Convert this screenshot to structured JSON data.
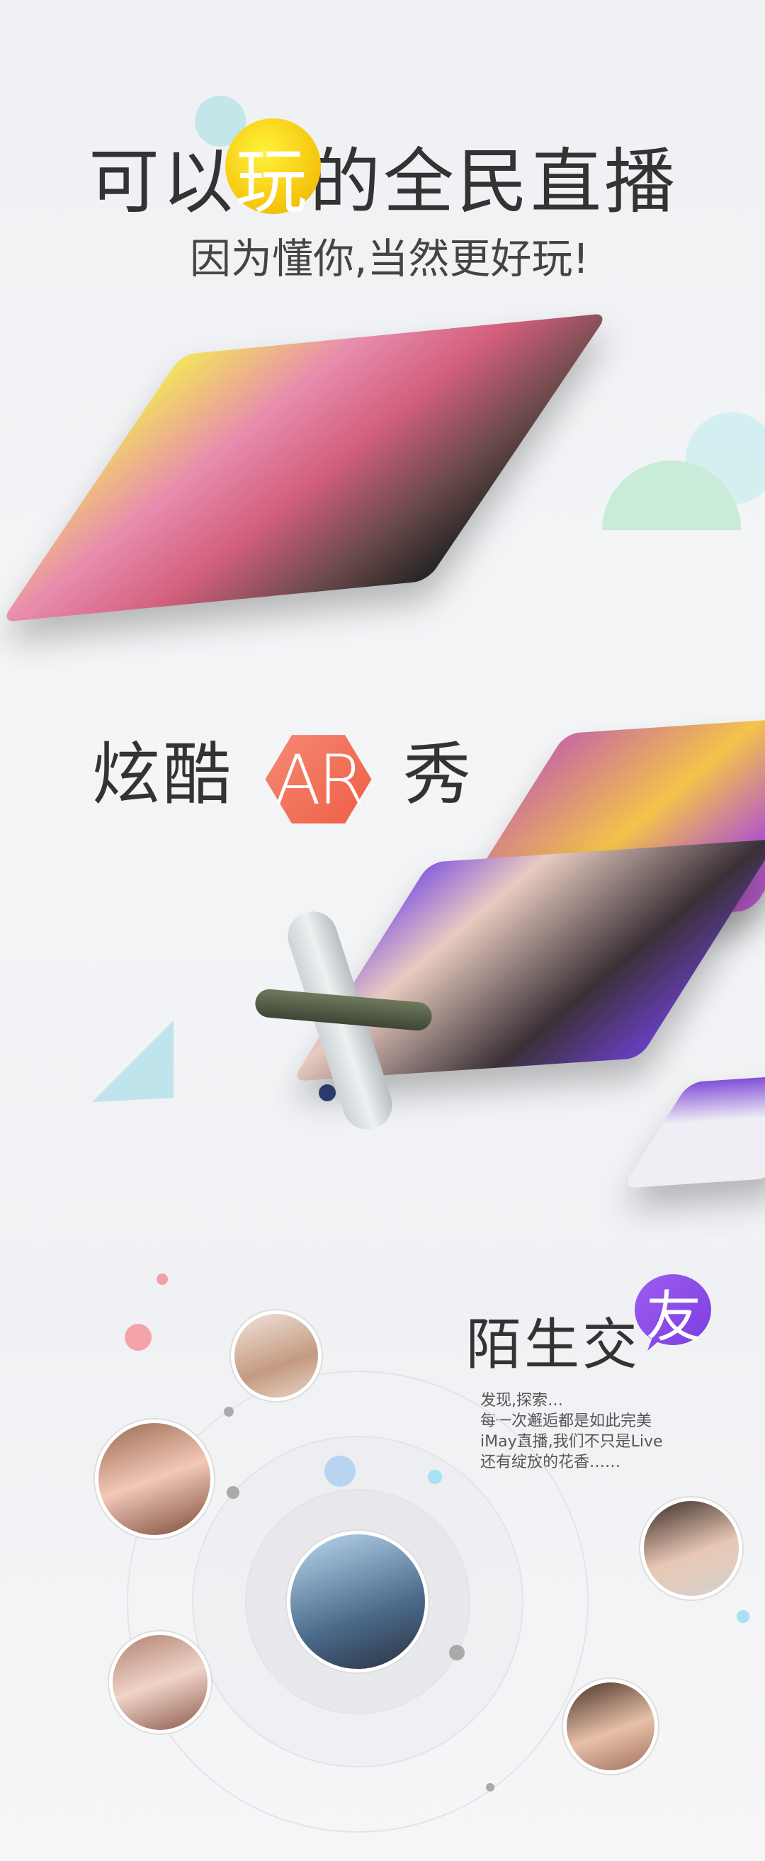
{
  "section1": {
    "title_before": "可以",
    "title_highlight": "玩",
    "title_after": "的全民直播",
    "subtitle": "因为懂你,当然更好玩!"
  },
  "section2": {
    "title_before": "炫酷",
    "title_highlight": "AR",
    "title_after": "秀"
  },
  "section3": {
    "title_main": "陌生交",
    "title_highlight": "友",
    "description": [
      "发现,探索…",
      "每一次邂逅都是如此完美",
      "iMay直播,我们不只是Live",
      "还有绽放的花香……"
    ]
  },
  "colors": {
    "yellow": "#f7d21a",
    "coral": "#f26a52",
    "purple": "#8b4de8",
    "teal": "#b9e3e6"
  }
}
